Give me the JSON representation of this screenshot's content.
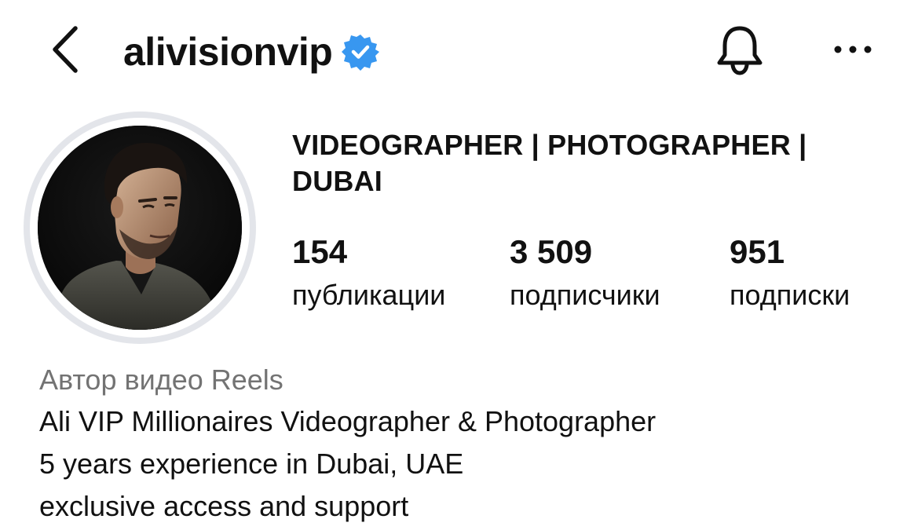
{
  "header": {
    "username": "alivisionvip",
    "icons": {
      "back": "chevron-left-icon",
      "verified": "verified-badge-icon",
      "notifications": "bell-icon",
      "more": "more-horizontal-icon"
    }
  },
  "profile": {
    "full_name": "VIDEOGRAPHER | PHOTOGRAPHER | DUBAI",
    "stats": {
      "posts": {
        "value": "154",
        "label": "публикации"
      },
      "followers": {
        "value": "3 509",
        "label": "подписчики"
      },
      "following": {
        "value": "951",
        "label": "подписки"
      }
    },
    "category": "Автор видео Reels",
    "bio_lines": [
      "Ali VIP Millionaires Videographer & Photographer",
      "5 years experience in Dubai, UAE",
      "exclusive access and support"
    ]
  },
  "colors": {
    "verified_blue": "#3897f0",
    "text_primary": "#111111",
    "text_secondary": "#737373",
    "avatar_ring": "#e3e5ea"
  }
}
